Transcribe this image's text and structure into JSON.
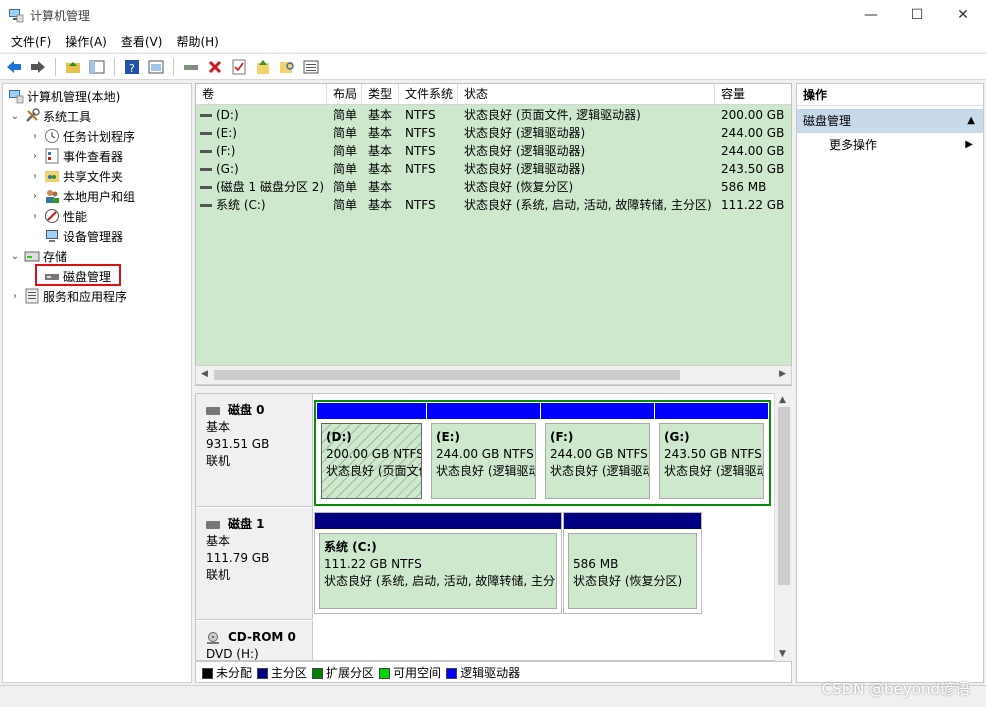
{
  "window": {
    "title": "计算机管理"
  },
  "menu": [
    "文件(F)",
    "操作(A)",
    "查看(V)",
    "帮助(H)"
  ],
  "tree": {
    "root": "计算机管理(本地)",
    "system_tools": "系统工具",
    "task_scheduler": "任务计划程序",
    "event_viewer": "事件查看器",
    "shared_folders": "共享文件夹",
    "local_users": "本地用户和组",
    "performance": "性能",
    "device_manager": "设备管理器",
    "storage": "存储",
    "disk_management": "磁盘管理",
    "services_apps": "服务和应用程序"
  },
  "volume_table": {
    "headers": [
      "卷",
      "布局",
      "类型",
      "文件系统",
      "状态",
      "容量"
    ],
    "rows": [
      {
        "vol": "(D:)",
        "layout": "简单",
        "type": "基本",
        "fs": "NTFS",
        "status": "状态良好 (页面文件, 逻辑驱动器)",
        "cap": "200.00 GB"
      },
      {
        "vol": "(E:)",
        "layout": "简单",
        "type": "基本",
        "fs": "NTFS",
        "status": "状态良好 (逻辑驱动器)",
        "cap": "244.00 GB"
      },
      {
        "vol": "(F:)",
        "layout": "简单",
        "type": "基本",
        "fs": "NTFS",
        "status": "状态良好 (逻辑驱动器)",
        "cap": "244.00 GB"
      },
      {
        "vol": "(G:)",
        "layout": "简单",
        "type": "基本",
        "fs": "NTFS",
        "status": "状态良好 (逻辑驱动器)",
        "cap": "243.50 GB"
      },
      {
        "vol": "(磁盘 1 磁盘分区 2)",
        "layout": "简单",
        "type": "基本",
        "fs": "",
        "status": "状态良好 (恢复分区)",
        "cap": "586 MB"
      },
      {
        "vol": "系统 (C:)",
        "layout": "简单",
        "type": "基本",
        "fs": "NTFS",
        "status": "状态良好 (系统, 启动, 活动, 故障转储, 主分区)",
        "cap": "111.22 GB"
      }
    ]
  },
  "disks": [
    {
      "name": "磁盘 0",
      "type": "基本",
      "size": "931.51 GB",
      "state": "联机",
      "partitions": [
        {
          "name": "(D:)",
          "size": "200.00 GB NTFS",
          "status": "状态良好 (页面文件"
        },
        {
          "name": "(E:)",
          "size": "244.00 GB NTFS",
          "status": "状态良好 (逻辑驱动"
        },
        {
          "name": "(F:)",
          "size": "244.00 GB NTFS",
          "status": "状态良好 (逻辑驱动"
        },
        {
          "name": "(G:)",
          "size": "243.50 GB NTFS",
          "status": "状态良好 (逻辑驱动"
        }
      ]
    },
    {
      "name": "磁盘 1",
      "type": "基本",
      "size": "111.79 GB",
      "state": "联机",
      "partitions": [
        {
          "name": "系统  (C:)",
          "size": "111.22 GB NTFS",
          "status": "状态良好 (系统, 启动, 活动, 故障转储, 主分区"
        },
        {
          "name": "",
          "size": "586 MB",
          "status": "状态良好 (恢复分区)"
        }
      ]
    },
    {
      "name": "CD-ROM 0",
      "type": "DVD (H:)"
    }
  ],
  "legend": [
    "未分配",
    "主分区",
    "扩展分区",
    "可用空间",
    "逻辑驱动器"
  ],
  "colors": {
    "unallocated": "#000000",
    "primary": "#000080",
    "extended": "#008000",
    "free": "#00d800",
    "logical": "#0000ff",
    "volume_bg": "#cde8cd"
  },
  "actions": {
    "header": "操作",
    "section": "磁盘管理",
    "more": "更多操作"
  },
  "watermark": "CSDN @beyond谚语"
}
